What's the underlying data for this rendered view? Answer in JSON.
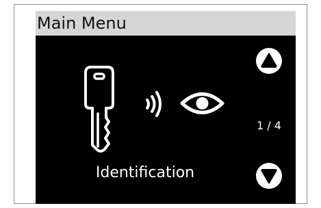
{
  "screen": {
    "title": "Main Menu",
    "menu_item_label": "Identification",
    "page_indicator": "1 / 4"
  },
  "icons": {
    "key": "key-icon",
    "nfc": "nfc-icon",
    "eye": "eye-icon",
    "up": "triangle-up-icon",
    "down": "triangle-down-icon"
  },
  "colors": {
    "title_bar_bg": "#d6d6d6",
    "screen_bg": "#000000",
    "foreground": "#ffffff"
  }
}
